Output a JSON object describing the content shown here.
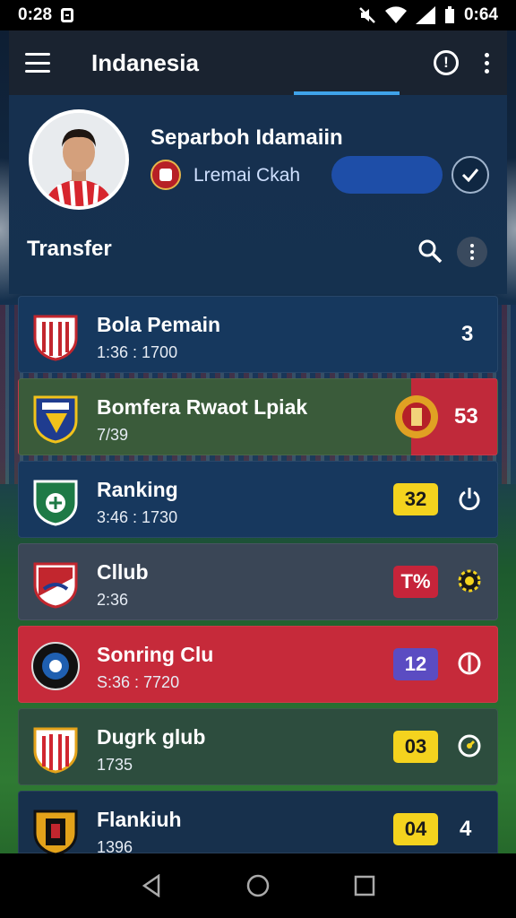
{
  "status_bar": {
    "time": "0:28",
    "right_time": "0:64"
  },
  "app_bar": {
    "title": "Indanesia"
  },
  "profile": {
    "name": "Separboh Idamaiin",
    "club": "Lremai Ckah"
  },
  "section": {
    "title": "Transfer"
  },
  "list": [
    {
      "title": "Bola Pemain",
      "sub": "1:36 : 1700",
      "value": "3",
      "style": "plain",
      "bg": "#16385e"
    },
    {
      "title": "Bomfera Rwaot Lpiak",
      "sub": "7/39",
      "value": "53",
      "style": "split",
      "bg": "#3a5a3a"
    },
    {
      "title": "Ranking",
      "sub": "3:46 : 1730",
      "value": "32",
      "style": "yellow",
      "bg": "#17385e"
    },
    {
      "title": "Cllub",
      "sub": "2:36",
      "value": "T%",
      "style": "red",
      "bg": "#3a4656"
    },
    {
      "title": "Sonring Clu",
      "sub": "S:36 : 7720",
      "value": "12",
      "style": "purple",
      "bg": "#c62a3a"
    },
    {
      "title": "Dugrk glub",
      "sub": "1735",
      "value": "03",
      "style": "yellow",
      "bg": "#2d4d3e"
    },
    {
      "title": "Flankiuh",
      "sub": "1396",
      "value": "04",
      "style": "yellow",
      "extra": "4",
      "bg": "#17304c"
    }
  ],
  "colors": {
    "accent": "#3fa3ea",
    "badge_yellow": "#f4d31e",
    "badge_red": "#c6243a",
    "badge_purple": "#5b4cc2"
  }
}
